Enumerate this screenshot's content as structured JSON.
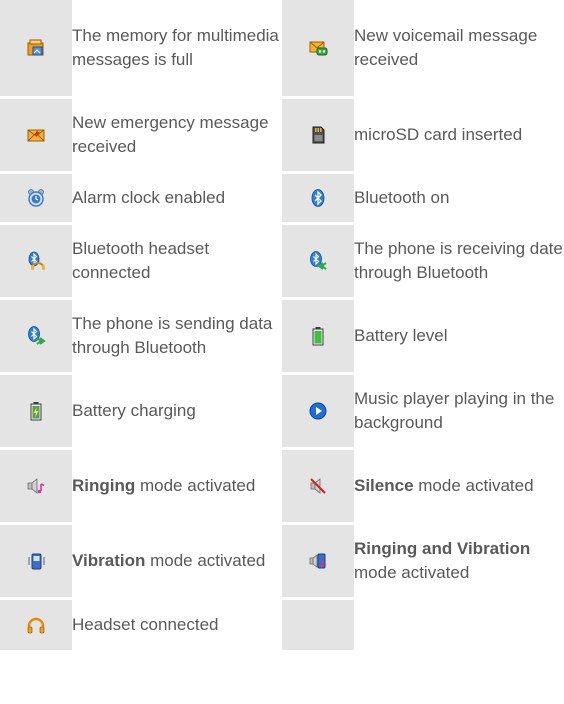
{
  "rows": [
    {
      "left": {
        "icon": "mms-memory-full-icon",
        "text": "The memory for multimedia messages is full"
      },
      "right": {
        "icon": "voicemail-icon",
        "text": "New voicemail message received"
      }
    },
    {
      "left": {
        "icon": "emergency-message-icon",
        "text": "New emergency message received"
      },
      "right": {
        "icon": "microsd-card-icon",
        "text": "microSD card inserted"
      }
    },
    {
      "left": {
        "icon": "alarm-clock-icon",
        "text": "Alarm clock enabled"
      },
      "right": {
        "icon": "bluetooth-icon",
        "text": "Bluetooth on"
      }
    },
    {
      "left": {
        "icon": "bluetooth-headset-icon",
        "text": "Bluetooth headset connected"
      },
      "right": {
        "icon": "bluetooth-receiving-icon",
        "text": "The phone is receiving date through Bluetooth"
      }
    },
    {
      "left": {
        "icon": "bluetooth-sending-icon",
        "text": "The phone is sending data through Bluetooth"
      },
      "right": {
        "icon": "battery-level-icon",
        "text": "Battery level"
      }
    },
    {
      "left": {
        "icon": "battery-charging-icon",
        "text": "Battery charging"
      },
      "right": {
        "icon": "music-playing-icon",
        "text": "Music player playing in the background"
      }
    },
    {
      "left": {
        "icon": "ringing-mode-icon",
        "bold": "Ringing",
        "text": " mode activated"
      },
      "right": {
        "icon": "silence-mode-icon",
        "bold": "Silence",
        "text": " mode activated"
      }
    },
    {
      "left": {
        "icon": "vibration-mode-icon",
        "bold": "Vibration",
        "text": " mode activated"
      },
      "right": {
        "icon": "ringing-vibration-mode-icon",
        "bold": "Ringing and Vibration",
        "text": " mode activated"
      }
    },
    {
      "left": {
        "icon": "headset-icon",
        "text": "Headset connected"
      }
    }
  ]
}
